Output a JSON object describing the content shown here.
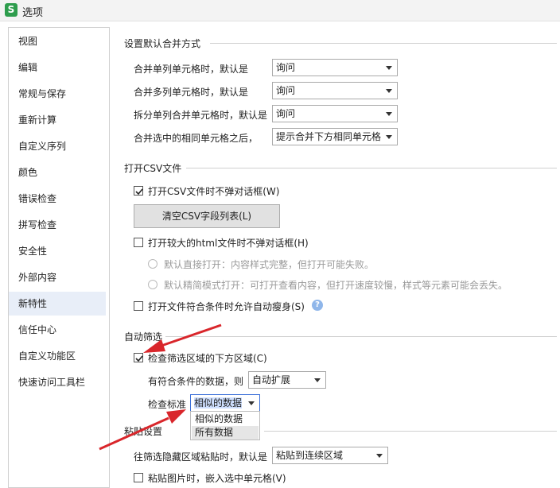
{
  "window": {
    "icon_letter": "S",
    "title": "选项"
  },
  "sidebar": {
    "items": [
      {
        "label": "视图"
      },
      {
        "label": "编辑"
      },
      {
        "label": "常规与保存"
      },
      {
        "label": "重新计算"
      },
      {
        "label": "自定义序列"
      },
      {
        "label": "颜色"
      },
      {
        "label": "错误检查"
      },
      {
        "label": "拼写检查"
      },
      {
        "label": "安全性"
      },
      {
        "label": "外部内容"
      },
      {
        "label": "新特性",
        "active": true
      },
      {
        "label": "信任中心"
      },
      {
        "label": "自定义功能区"
      },
      {
        "label": "快速访问工具栏"
      }
    ]
  },
  "merge_section": {
    "title": "设置默认合并方式",
    "rows": [
      {
        "label": "合并单列单元格时，默认是",
        "value": "询问"
      },
      {
        "label": "合并多列单元格时，默认是",
        "value": "询问"
      },
      {
        "label": "拆分单列合并单元格时，默认是",
        "value": "询问"
      },
      {
        "label": "合并选中的相同单元格之后，",
        "value": "提示合并下方相同单元格"
      }
    ]
  },
  "csv_section": {
    "title": "打开CSV文件",
    "no_dialog_csv": {
      "label": "打开CSV文件时不弹对话框(W)",
      "checked": true
    },
    "clear_button": "清空CSV字段列表(L)",
    "no_dialog_html": {
      "label": "打开较大的html文件时不弹对话框(H)",
      "checked": false
    },
    "radio_direct": "默认直接打开：内容样式完整，但打开可能失败。",
    "radio_simple": "默认精简模式打开：可打开查看内容，但打开速度较慢，样式等元素可能会丢失。",
    "auto_slim": {
      "label": "打开文件符合条件时允许自动瘦身(S)",
      "checked": false
    },
    "help": "?"
  },
  "filter_section": {
    "title": "自动筛选",
    "check_below": {
      "label": "检查筛选区域的下方区域(C)",
      "checked": true
    },
    "matching_label": "有符合条件的数据，则",
    "matching_value": "自动扩展",
    "standard_label": "检查标准",
    "standard_value": "相似的数据",
    "standard_options": [
      "相似的数据",
      "所有数据"
    ]
  },
  "paste_section": {
    "title": "粘贴设置",
    "hidden_paste_label": "往筛选隐藏区域粘贴时，默认是",
    "hidden_paste_value": "粘贴到连续区域",
    "embed_picture": {
      "label": "粘贴图片时，嵌入选中单元格(V)",
      "checked": false
    }
  },
  "colors": {
    "accent": "#3a6fd8",
    "annotation_arrow": "#d9262b",
    "active_item": "#e8eef8"
  }
}
